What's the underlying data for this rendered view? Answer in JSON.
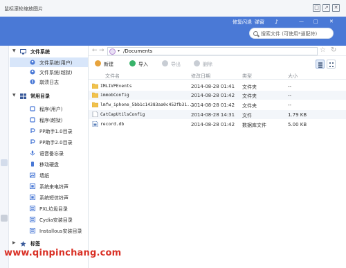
{
  "window": {
    "title": "鼠标滚轮缩放图片",
    "controls": [
      "□",
      "↗",
      "✕"
    ]
  },
  "header": {
    "nav": [
      "修复闪退",
      "弹窗",
      "♪",
      "—",
      "□",
      "✕"
    ],
    "search_placeholder": "搜索文件 (可使用*通配符)"
  },
  "sidebar": {
    "sections": [
      {
        "label": "文件系统",
        "icon": "monitor-icon"
      },
      {
        "label": "常用目录",
        "icon": "grid-icon"
      },
      {
        "label": "标签",
        "icon": "star-icon"
      }
    ],
    "items": [
      {
        "label": "文件系统(用户)",
        "icon": "user-folder-icon",
        "active": true
      },
      {
        "label": "文件系统(越狱)",
        "icon": "user-folder-icon",
        "active": false
      },
      {
        "label": "崩溃日志",
        "icon": "log-icon",
        "active": false
      },
      {
        "label": "程序(用户)",
        "icon": "program-icon",
        "active": false
      },
      {
        "label": "程序(越狱)",
        "icon": "program-icon",
        "active": false
      },
      {
        "label": "PP助手1.0目录",
        "icon": "pp-icon",
        "active": false
      },
      {
        "label": "PP助手2.0目录",
        "icon": "pp-icon",
        "active": false
      },
      {
        "label": "语音备忘录",
        "icon": "mic-icon",
        "active": false
      },
      {
        "label": "移动硬盘",
        "icon": "disk-icon",
        "active": false
      },
      {
        "label": "墙纸",
        "icon": "wallpaper-icon",
        "active": false
      },
      {
        "label": "系统来电铃声",
        "icon": "ringtone-icon",
        "active": false
      },
      {
        "label": "系统短信铃声",
        "icon": "ringtone-icon",
        "active": false
      },
      {
        "label": "PXL垃圾目录",
        "icon": "trash-folder-icon",
        "active": false
      },
      {
        "label": "Cydia安装目录",
        "icon": "cydia-folder-icon",
        "active": false
      },
      {
        "label": "Installous安装目录",
        "icon": "install-folder-icon",
        "active": false
      }
    ]
  },
  "address": {
    "path": "/Documents",
    "back": "←",
    "forward": "→",
    "dropdown": "▾"
  },
  "toolbar": {
    "new_label": "新建",
    "import_label": "导入",
    "export_label": "导出",
    "delete_label": "删除"
  },
  "columns": {
    "name": "文件名",
    "modified": "修改日期",
    "type": "类型",
    "size": "大小"
  },
  "files": [
    {
      "name": "IMLIVPEvents",
      "modified": "2014-08-28 01:41",
      "type": "文件夹",
      "size": "--",
      "icon": "folder-icon"
    },
    {
      "name": "immobConfig",
      "modified": "2014-08-28 01:42",
      "type": "文件夹",
      "size": "--",
      "icon": "folder-icon"
    },
    {
      "name": "lmfw_iphone_5bb1c14383aa0c452fb31...",
      "modified": "2014-08-28 01:42",
      "type": "文件夹",
      "size": "--",
      "icon": "folder-icon"
    },
    {
      "name": "CatCapUtilsConfig",
      "modified": "2014-08-28 14:31",
      "type": "文件",
      "size": "1.79 KB",
      "icon": "file-icon"
    },
    {
      "name": "record.db",
      "modified": "2014-08-28 01:42",
      "type": "数据库文件",
      "size": "5.00 KB",
      "icon": "db-file-icon"
    }
  ],
  "watermark": "www.qinpinchang.com",
  "colors": {
    "header_blue": "#4a79d6",
    "active_row": "#d8e6fa",
    "folder": "#f1c24c",
    "watermark_red": "#d93025"
  }
}
